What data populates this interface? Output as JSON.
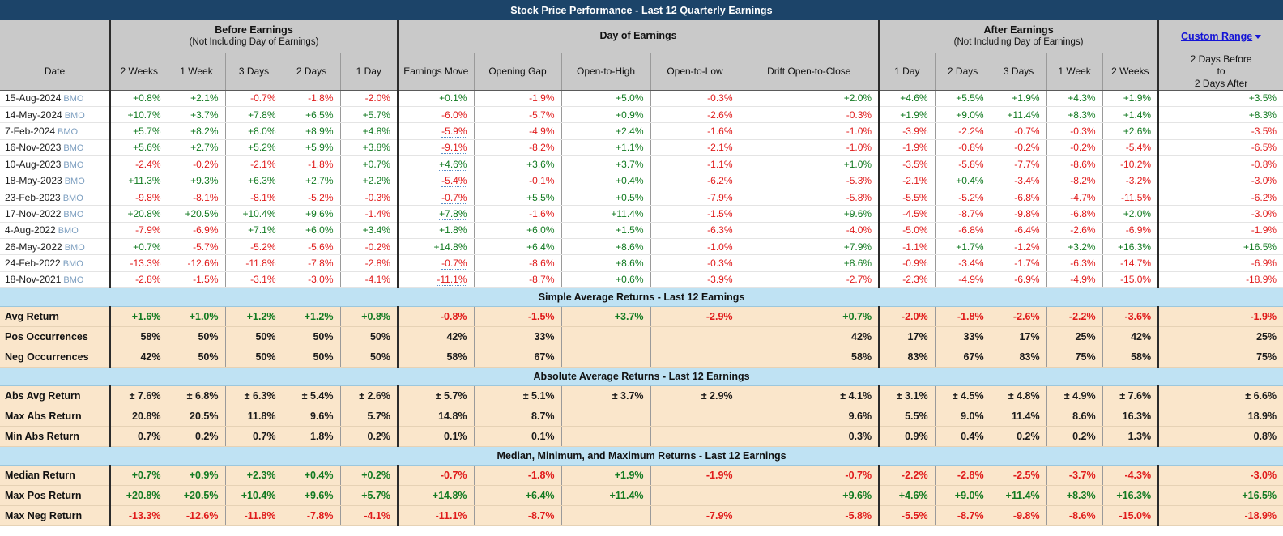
{
  "title": "Stock Price Performance - Last 12 Quarterly Earnings",
  "header": {
    "groups": [
      {
        "title": "Before Earnings",
        "sub": "(Not Including Day of Earnings)"
      },
      {
        "title": "Day of Earnings",
        "sub": ""
      },
      {
        "title": "After Earnings",
        "sub": "(Not Including Day of Earnings)"
      }
    ],
    "custom_range_label": "Custom Range",
    "custom_range_color": "#1414d6",
    "columns": [
      "Date",
      "2 Weeks",
      "1 Week",
      "3 Days",
      "2 Days",
      "1 Day",
      "Earnings Move",
      "Opening Gap",
      "Open-to-High",
      "Open-to-Low",
      "Drift Open-to-Close",
      "1 Day",
      "2 Days",
      "3 Days",
      "1 Week",
      "2 Weeks",
      "2 Days Before\nto\n2 Days After"
    ],
    "last_col_line1": "2 Days Before",
    "last_col_line2": "to",
    "last_col_line3": "2 Days After"
  },
  "colors": {
    "positive": "#127a21",
    "negative": "#e01b1b",
    "title_bar": "#1c4469",
    "header_bg": "#c9c9c9",
    "banner_bg": "#bfe2f3",
    "stat_bg": "#fae6cb",
    "bmo": "#7d9fc0"
  },
  "rows": [
    {
      "date": "15-Aug-2024",
      "tag": "BMO",
      "vals": [
        "+0.8%",
        "+2.1%",
        "-0.7%",
        "-1.8%",
        "-2.0%",
        "+0.1%",
        "-1.9%",
        "+5.0%",
        "-0.3%",
        "+2.0%",
        "+4.6%",
        "+5.5%",
        "+1.9%",
        "+4.3%",
        "+1.9%",
        "+3.5%"
      ]
    },
    {
      "date": "14-May-2024",
      "tag": "BMO",
      "vals": [
        "+10.7%",
        "+3.7%",
        "+7.8%",
        "+6.5%",
        "+5.7%",
        "-6.0%",
        "-5.7%",
        "+0.9%",
        "-2.6%",
        "-0.3%",
        "+1.9%",
        "+9.0%",
        "+11.4%",
        "+8.3%",
        "+1.4%",
        "+8.3%"
      ]
    },
    {
      "date": "7-Feb-2024",
      "tag": "BMO",
      "vals": [
        "+5.7%",
        "+8.2%",
        "+8.0%",
        "+8.9%",
        "+4.8%",
        "-5.9%",
        "-4.9%",
        "+2.4%",
        "-1.6%",
        "-1.0%",
        "-3.9%",
        "-2.2%",
        "-0.7%",
        "-0.3%",
        "+2.6%",
        "-3.5%"
      ]
    },
    {
      "date": "16-Nov-2023",
      "tag": "BMO",
      "vals": [
        "+5.6%",
        "+2.7%",
        "+5.2%",
        "+5.9%",
        "+3.8%",
        "-9.1%",
        "-8.2%",
        "+1.1%",
        "-2.1%",
        "-1.0%",
        "-1.9%",
        "-0.8%",
        "-0.2%",
        "-0.2%",
        "-5.4%",
        "-6.5%"
      ]
    },
    {
      "date": "10-Aug-2023",
      "tag": "BMO",
      "vals": [
        "-2.4%",
        "-0.2%",
        "-2.1%",
        "-1.8%",
        "+0.7%",
        "+4.6%",
        "+3.6%",
        "+3.7%",
        "-1.1%",
        "+1.0%",
        "-3.5%",
        "-5.8%",
        "-7.7%",
        "-8.6%",
        "-10.2%",
        "-0.8%"
      ]
    },
    {
      "date": "18-May-2023",
      "tag": "BMO",
      "vals": [
        "+11.3%",
        "+9.3%",
        "+6.3%",
        "+2.7%",
        "+2.2%",
        "-5.4%",
        "-0.1%",
        "+0.4%",
        "-6.2%",
        "-5.3%",
        "-2.1%",
        "+0.4%",
        "-3.4%",
        "-8.2%",
        "-3.2%",
        "-3.0%"
      ]
    },
    {
      "date": "23-Feb-2023",
      "tag": "BMO",
      "vals": [
        "-9.8%",
        "-8.1%",
        "-8.1%",
        "-5.2%",
        "-0.3%",
        "-0.7%",
        "+5.5%",
        "+0.5%",
        "-7.9%",
        "-5.8%",
        "-5.5%",
        "-5.2%",
        "-6.8%",
        "-4.7%",
        "-11.5%",
        "-6.2%"
      ]
    },
    {
      "date": "17-Nov-2022",
      "tag": "BMO",
      "vals": [
        "+20.8%",
        "+20.5%",
        "+10.4%",
        "+9.6%",
        "-1.4%",
        "+7.8%",
        "-1.6%",
        "+11.4%",
        "-1.5%",
        "+9.6%",
        "-4.5%",
        "-8.7%",
        "-9.8%",
        "-6.8%",
        "+2.0%",
        "-3.0%"
      ]
    },
    {
      "date": "4-Aug-2022",
      "tag": "BMO",
      "vals": [
        "-7.9%",
        "-6.9%",
        "+7.1%",
        "+6.0%",
        "+3.4%",
        "+1.8%",
        "+6.0%",
        "+1.5%",
        "-6.3%",
        "-4.0%",
        "-5.0%",
        "-6.8%",
        "-6.4%",
        "-2.6%",
        "-6.9%",
        "-1.9%"
      ]
    },
    {
      "date": "26-May-2022",
      "tag": "BMO",
      "vals": [
        "+0.7%",
        "-5.7%",
        "-5.2%",
        "-5.6%",
        "-0.2%",
        "+14.8%",
        "+6.4%",
        "+8.6%",
        "-1.0%",
        "+7.9%",
        "-1.1%",
        "+1.7%",
        "-1.2%",
        "+3.2%",
        "+16.3%",
        "+16.5%"
      ]
    },
    {
      "date": "24-Feb-2022",
      "tag": "BMO",
      "vals": [
        "-13.3%",
        "-12.6%",
        "-11.8%",
        "-7.8%",
        "-2.8%",
        "-0.7%",
        "-8.6%",
        "+8.6%",
        "-0.3%",
        "+8.6%",
        "-0.9%",
        "-3.4%",
        "-1.7%",
        "-6.3%",
        "-14.7%",
        "-6.9%"
      ]
    },
    {
      "date": "18-Nov-2021",
      "tag": "BMO",
      "vals": [
        "-2.8%",
        "-1.5%",
        "-3.1%",
        "-3.0%",
        "-4.1%",
        "-11.1%",
        "-8.7%",
        "+0.6%",
        "-3.9%",
        "-2.7%",
        "-2.3%",
        "-4.9%",
        "-6.9%",
        "-4.9%",
        "-15.0%",
        "-18.9%"
      ]
    }
  ],
  "sections": [
    {
      "banner": "Simple Average Returns - Last 12 Earnings",
      "rows": [
        {
          "label": "Avg Return",
          "colored": true,
          "vals": [
            "+1.6%",
            "+1.0%",
            "+1.2%",
            "+1.2%",
            "+0.8%",
            "-0.8%",
            "-1.5%",
            "+3.7%",
            "-2.9%",
            "+0.7%",
            "-2.0%",
            "-1.8%",
            "-2.6%",
            "-2.2%",
            "-3.6%",
            "-1.9%"
          ]
        },
        {
          "label": "Pos Occurrences",
          "colored": false,
          "vals": [
            "58%",
            "50%",
            "50%",
            "50%",
            "50%",
            "42%",
            "33%",
            "",
            "",
            "42%",
            "17%",
            "33%",
            "17%",
            "25%",
            "42%",
            "25%"
          ]
        },
        {
          "label": "Neg Occurrences",
          "colored": false,
          "vals": [
            "42%",
            "50%",
            "50%",
            "50%",
            "50%",
            "58%",
            "67%",
            "",
            "",
            "58%",
            "83%",
            "67%",
            "83%",
            "75%",
            "58%",
            "75%"
          ]
        }
      ]
    },
    {
      "banner": "Absolute Average Returns - Last 12 Earnings",
      "rows": [
        {
          "label": "Abs Avg Return",
          "colored": false,
          "vals": [
            "± 7.6%",
            "± 6.8%",
            "± 6.3%",
            "± 5.4%",
            "± 2.6%",
            "± 5.7%",
            "± 5.1%",
            "± 3.7%",
            "± 2.9%",
            "± 4.1%",
            "± 3.1%",
            "± 4.5%",
            "± 4.8%",
            "± 4.9%",
            "± 7.6%",
            "± 6.6%"
          ]
        },
        {
          "label": "Max Abs Return",
          "colored": false,
          "vals": [
            "20.8%",
            "20.5%",
            "11.8%",
            "9.6%",
            "5.7%",
            "14.8%",
            "8.7%",
            "",
            "",
            "9.6%",
            "5.5%",
            "9.0%",
            "11.4%",
            "8.6%",
            "16.3%",
            "18.9%"
          ]
        },
        {
          "label": "Min Abs Return",
          "colored": false,
          "vals": [
            "0.7%",
            "0.2%",
            "0.7%",
            "1.8%",
            "0.2%",
            "0.1%",
            "0.1%",
            "",
            "",
            "0.3%",
            "0.9%",
            "0.4%",
            "0.2%",
            "0.2%",
            "1.3%",
            "0.8%"
          ]
        }
      ]
    },
    {
      "banner": "Median, Minimum, and Maximum Returns - Last 12 Earnings",
      "rows": [
        {
          "label": "Median Return",
          "colored": true,
          "vals": [
            "+0.7%",
            "+0.9%",
            "+2.3%",
            "+0.4%",
            "+0.2%",
            "-0.7%",
            "-1.8%",
            "+1.9%",
            "-1.9%",
            "-0.7%",
            "-2.2%",
            "-2.8%",
            "-2.5%",
            "-3.7%",
            "-4.3%",
            "-3.0%"
          ]
        },
        {
          "label": "Max Pos Return",
          "colored": true,
          "vals": [
            "+20.8%",
            "+20.5%",
            "+10.4%",
            "+9.6%",
            "+5.7%",
            "+14.8%",
            "+6.4%",
            "+11.4%",
            "",
            "+9.6%",
            "+4.6%",
            "+9.0%",
            "+11.4%",
            "+8.3%",
            "+16.3%",
            "+16.5%"
          ]
        },
        {
          "label": "Max Neg Return",
          "colored": true,
          "vals": [
            "-13.3%",
            "-12.6%",
            "-11.8%",
            "-7.8%",
            "-4.1%",
            "-11.1%",
            "-8.7%",
            "",
            "-7.9%",
            "-5.8%",
            "-5.5%",
            "-8.7%",
            "-9.8%",
            "-8.6%",
            "-15.0%",
            "-18.9%"
          ]
        }
      ]
    }
  ]
}
